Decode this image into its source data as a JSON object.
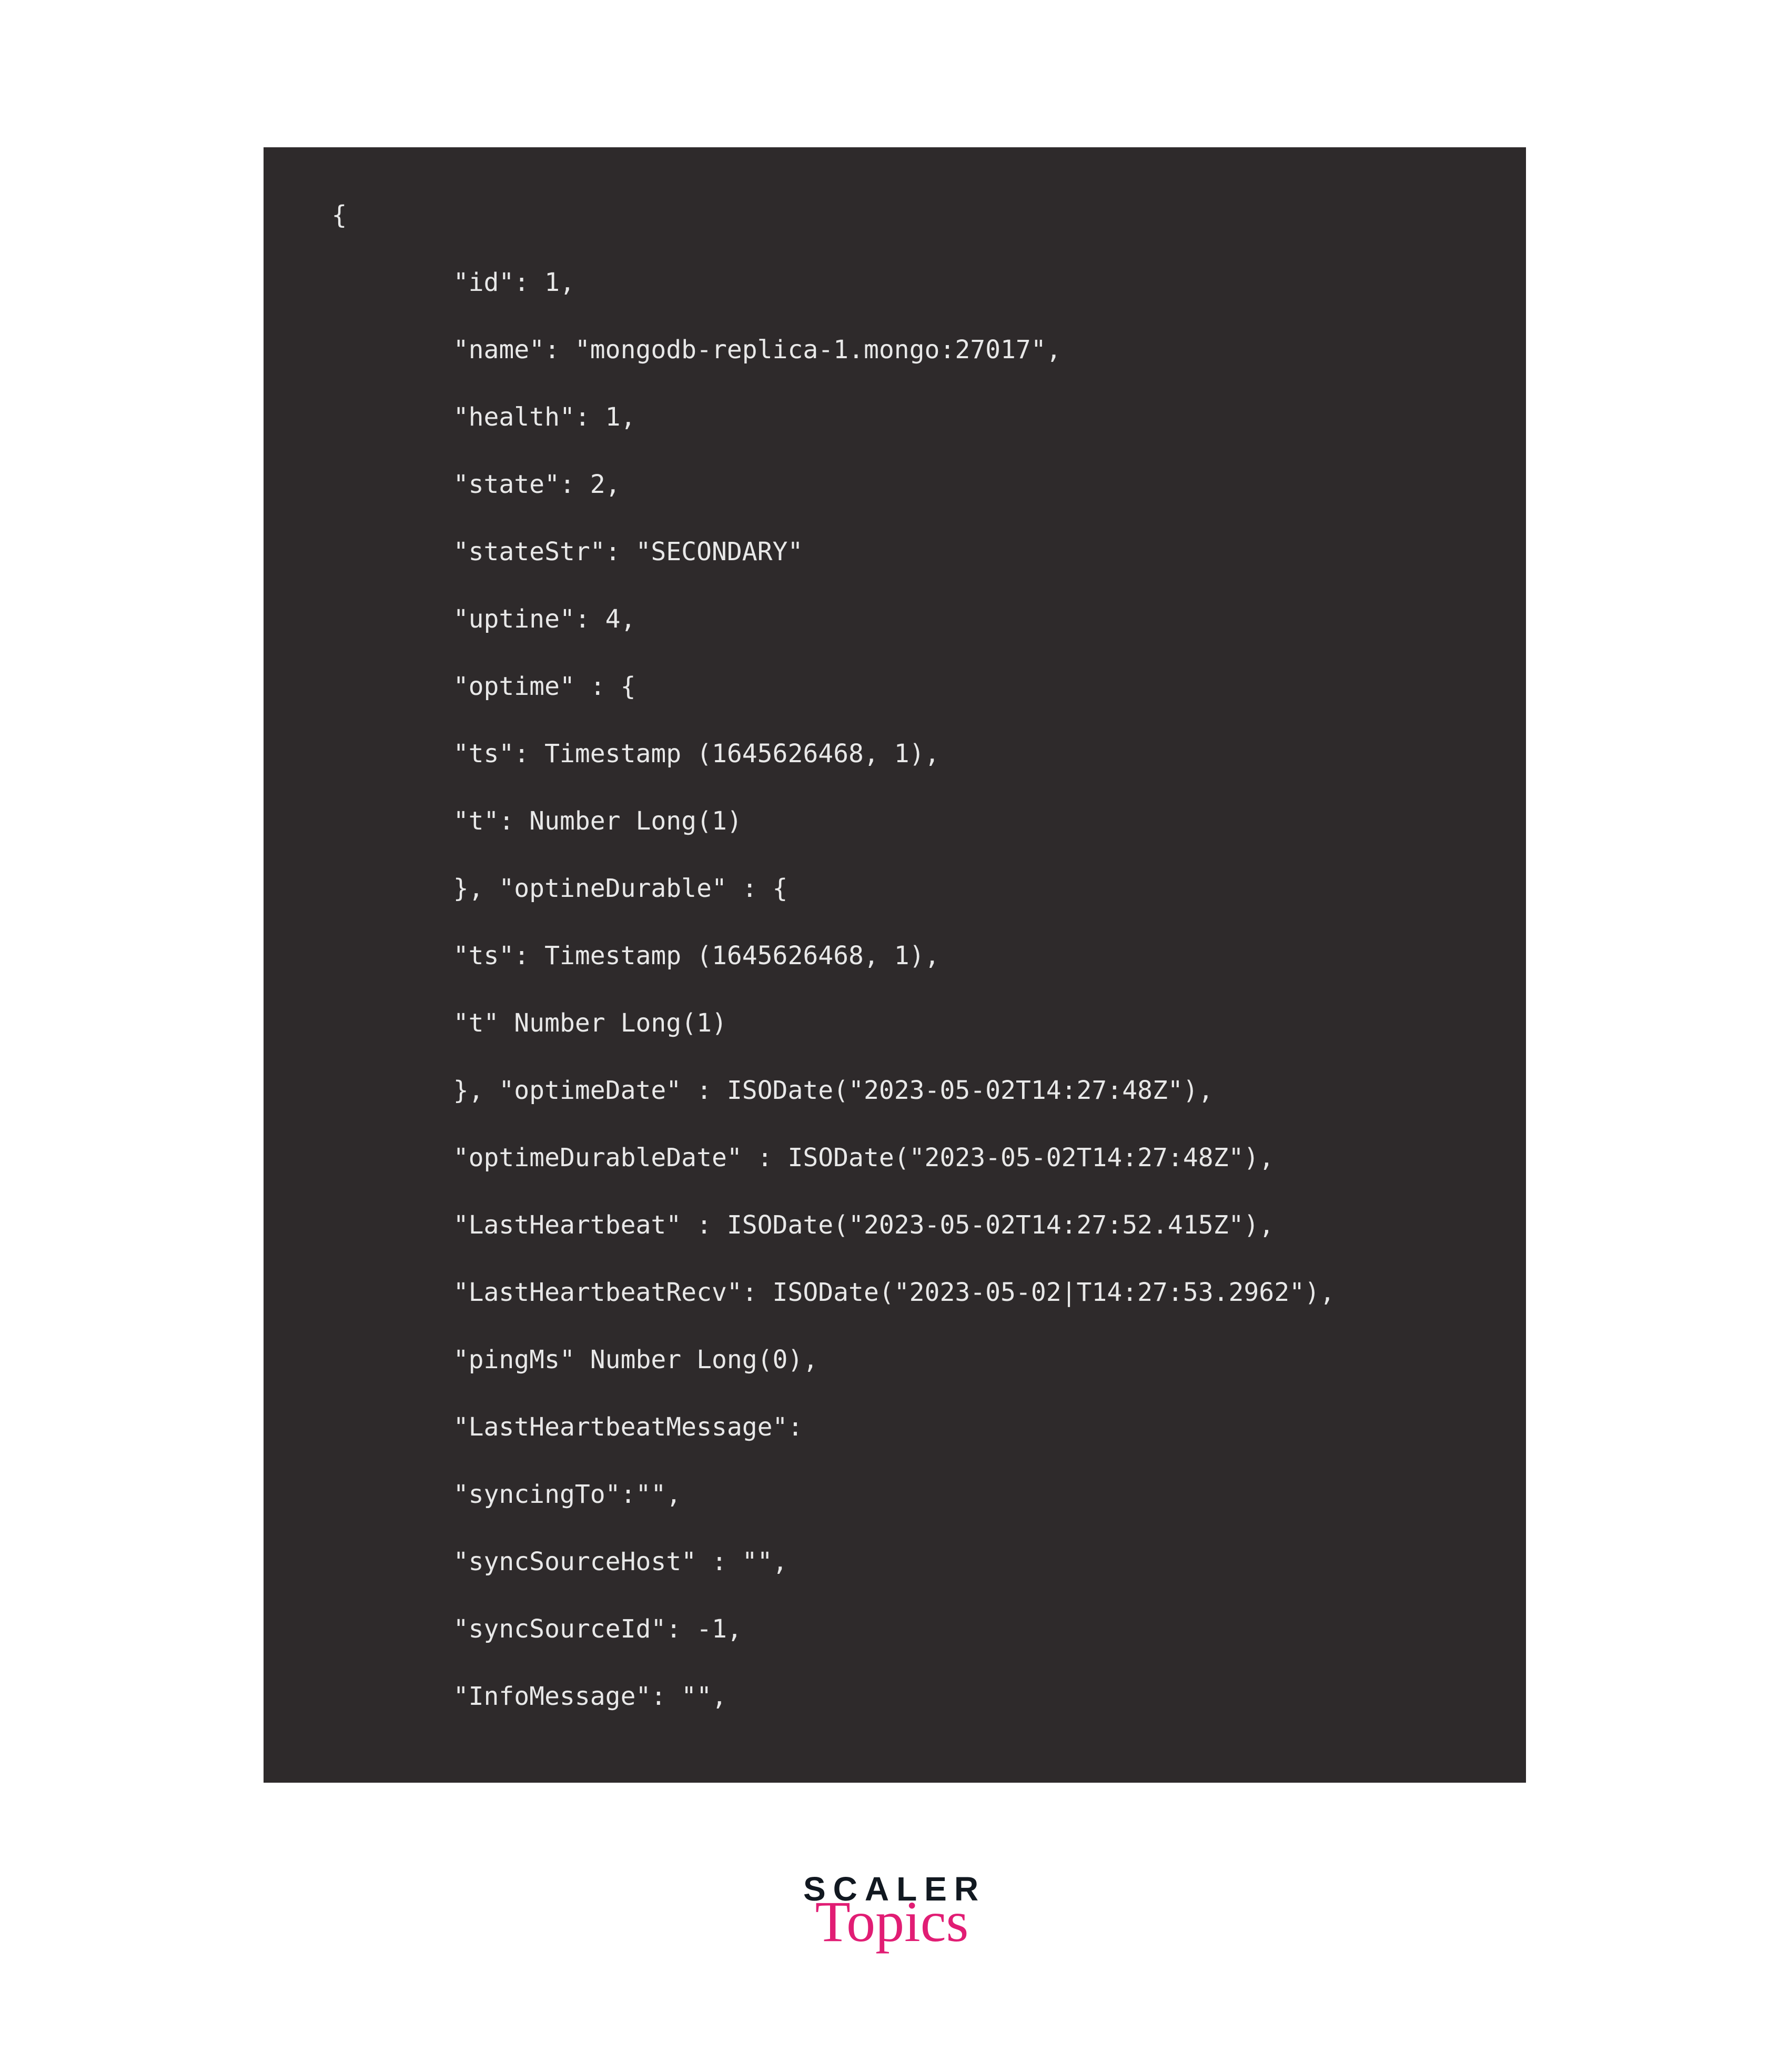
{
  "code": {
    "lines": [
      "{",
      "        \"id\": 1,",
      "        \"name\": \"mongodb-replica-1.mongo:27017\",",
      "        \"health\": 1,",
      "        \"state\": 2,",
      "        \"stateStr\": \"SECONDARY\"",
      "        \"uptine\": 4,",
      "        \"optime\" : {",
      "        \"ts\": Timestamp (1645626468, 1),",
      "        \"t\": Number Long(1)",
      "        }, \"optineDurable\" : {",
      "        \"ts\": Timestamp (1645626468, 1),",
      "        \"t\" Number Long(1)",
      "        }, \"optimeDate\" : ISODate(\"2023-05-02T14:27:48Z\"),",
      "        \"optimeDurableDate\" : ISODate(\"2023-05-02T14:27:48Z\"),",
      "        \"LastHeartbeat\" : ISODate(\"2023-05-02T14:27:52.415Z\"),",
      "        \"LastHeartbeatRecv\": ISODate(\"2023-05-02|T14:27:53.2962\"),",
      "        \"pingMs\" Number Long(0),",
      "        \"LastHeartbeatMessage\":",
      "        \"syncingTo\":\"\",",
      "        \"syncSourceHost\" : \"\",",
      "        \"syncSourceId\": -1,",
      "        \"InfoMessage\": \"\","
    ]
  },
  "logo": {
    "line1": "SCALER",
    "line2": "Topics"
  }
}
